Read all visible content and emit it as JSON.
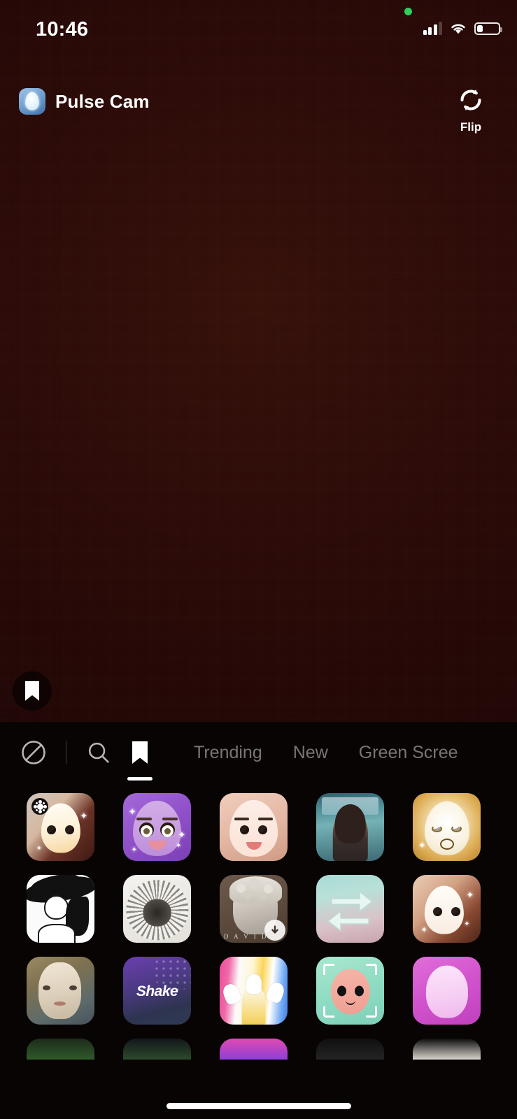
{
  "status_bar": {
    "time": "10:46",
    "privacy_indicator": "camera-active-green-dot",
    "cellular_icon": "cellular-signal-3-of-4-bars",
    "wifi_icon": "wifi-full-icon",
    "battery_icon": "battery-low-icon",
    "battery_level_percent": 25
  },
  "header": {
    "app_name": "Pulse Cam",
    "logo_icon": "pulse-cam-app-logo",
    "flip_label": "Flip",
    "flip_icon": "camera-flip-rotate-icon"
  },
  "viewfinder": {
    "saved_effects_icon": "bookmark-icon",
    "background_color": "#2c0a07"
  },
  "effect_panel": {
    "background_color": "#090404",
    "tabs": [
      {
        "id": "none",
        "type": "icon",
        "icon": "no-effect-circle-slash-icon",
        "label": "",
        "active": false
      },
      {
        "id": "search",
        "type": "icon",
        "icon": "search-icon",
        "label": "",
        "active": false
      },
      {
        "id": "saved",
        "type": "icon",
        "icon": "bookmark-icon",
        "label": "",
        "active": true
      },
      {
        "id": "trending",
        "type": "text",
        "icon": "",
        "label": "Trending",
        "active": false
      },
      {
        "id": "new",
        "type": "text",
        "icon": "",
        "label": "New",
        "active": false
      },
      {
        "id": "green-screen",
        "type": "text",
        "icon": "",
        "label": "Green Scree",
        "active": false
      }
    ],
    "active_tab_color": "#ffffff",
    "inactive_tab_color": "#7c7375",
    "rows": [
      {
        "tiles": [
          {
            "name": "beige-egg-face-effect",
            "has_download_badge": false
          },
          {
            "name": "purple-glam-doll-effect",
            "has_download_badge": false
          },
          {
            "name": "pink-smooth-face-effect",
            "has_download_badge": false
          },
          {
            "name": "teal-portrait-photo-effect",
            "has_download_badge": false
          },
          {
            "name": "golden-glow-face-effect",
            "has_download_badge": false
          }
        ]
      },
      {
        "tiles": [
          {
            "name": "comic-woman-hat-effect",
            "has_download_badge": false
          },
          {
            "name": "pencil-sunflower-sketch-effect",
            "has_download_badge": false
          },
          {
            "name": "david-statue-effect",
            "has_download_badge": true,
            "badge_icon": "download-arrow-icon"
          },
          {
            "name": "teal-swap-arrows-effect",
            "has_download_badge": false
          },
          {
            "name": "sparkle-skin-face-effect",
            "has_download_badge": false
          }
        ]
      },
      {
        "tiles": [
          {
            "name": "renaissance-portrait-effect",
            "has_download_badge": false
          },
          {
            "name": "shake-effect",
            "label": "Shake",
            "has_download_badge": false
          },
          {
            "name": "hands-colorful-effect",
            "has_download_badge": false
          },
          {
            "name": "green-scanner-face-effect",
            "has_download_badge": false
          },
          {
            "name": "magenta-blob-face-effect",
            "has_download_badge": false
          }
        ]
      }
    ]
  },
  "system": {
    "home_indicator": "home-indicator-bar"
  }
}
